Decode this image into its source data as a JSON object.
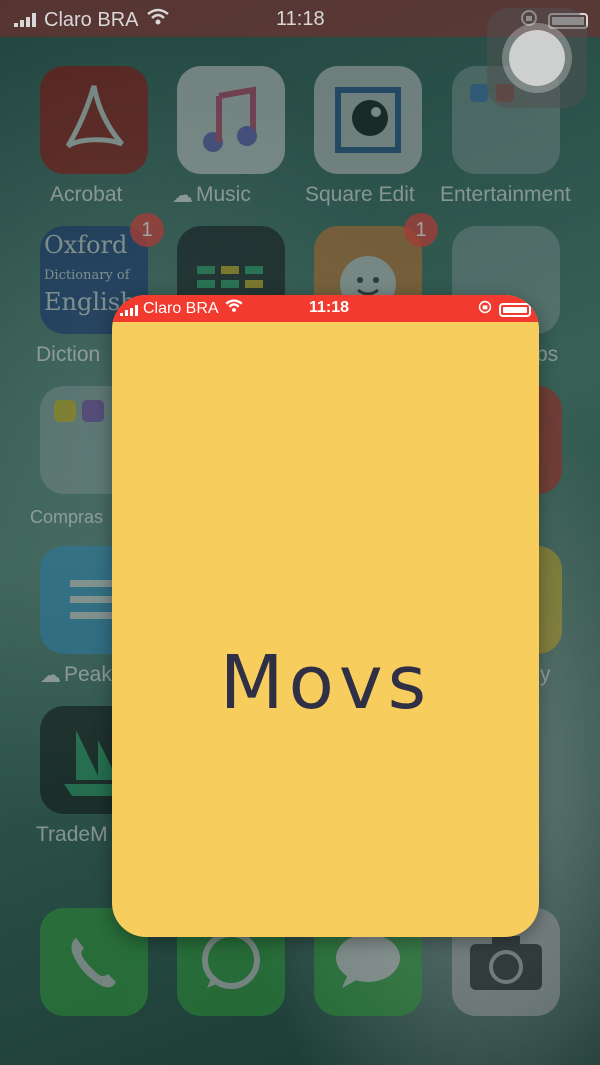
{
  "status_bar": {
    "carrier": "Claro BRA",
    "time": "11:18"
  },
  "home_screen": {
    "apps": [
      {
        "label": "Acrobat",
        "icon": "acrobat-icon"
      },
      {
        "label": "Music",
        "icon": "music-icon"
      },
      {
        "label": "Square Edit",
        "icon": "square-edit-icon"
      },
      {
        "label": "Entertainment",
        "icon": "entertainment-folder-icon"
      },
      {
        "label": "Diction",
        "icon": "oxford-dictionary-icon",
        "badge": "1",
        "text": "Oxford Dictionary of English"
      },
      {
        "label": "",
        "icon": "equalizer-app-icon"
      },
      {
        "label": "",
        "icon": "smiley-app-icon",
        "badge": "1"
      },
      {
        "label": "ps",
        "icon": "folder-icon"
      },
      {
        "label": "Compras",
        "icon": "compras-folder-icon"
      },
      {
        "label": "",
        "icon": "red-app-icon"
      },
      {
        "label": "Peak",
        "icon": "peak-icon"
      },
      {
        "label": "",
        "icon": "yellow-app-icon"
      },
      {
        "label": "TradeM",
        "icon": "trade-ship-icon"
      },
      {
        "label": "y",
        "icon": "app-icon"
      }
    ],
    "dock": [
      {
        "icon": "phone-icon"
      },
      {
        "icon": "whatsapp-icon"
      },
      {
        "icon": "messages-icon"
      },
      {
        "icon": "camera-icon"
      }
    ]
  },
  "splash": {
    "status_bar": {
      "carrier": "Claro BRA",
      "time": "11:18"
    },
    "title": "Movs",
    "background": "#f7cd5e",
    "status_color": "#f23a2e"
  }
}
